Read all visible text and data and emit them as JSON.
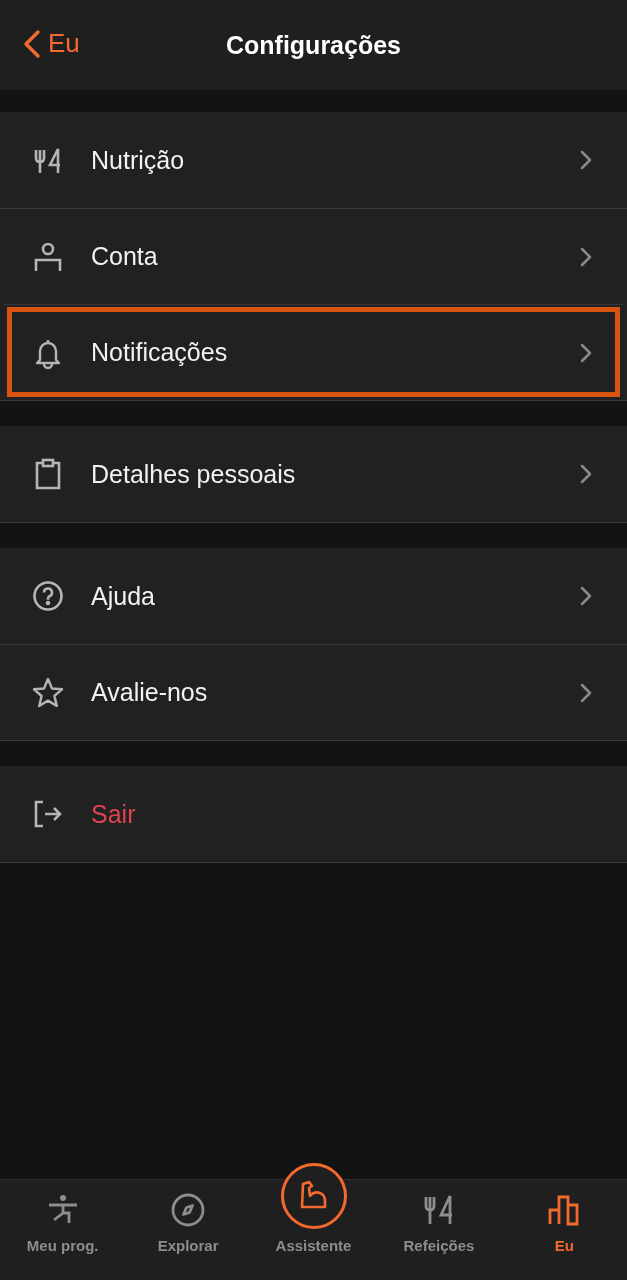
{
  "header": {
    "back_label": "Eu",
    "title": "Configurações"
  },
  "sections": [
    {
      "items": [
        {
          "label": "Nutrição",
          "kind": "link",
          "highlighted": false
        },
        {
          "label": "Conta",
          "kind": "link",
          "highlighted": false
        },
        {
          "label": "Notificações",
          "kind": "link",
          "highlighted": true
        }
      ]
    },
    {
      "items": [
        {
          "label": "Detalhes pessoais",
          "kind": "link",
          "highlighted": false
        }
      ]
    },
    {
      "items": [
        {
          "label": "Ajuda",
          "kind": "link",
          "highlighted": false
        },
        {
          "label": "Avalie-nos",
          "kind": "link",
          "highlighted": false
        }
      ]
    },
    {
      "items": [
        {
          "label": "Sair",
          "kind": "danger",
          "highlighted": false
        }
      ]
    }
  ],
  "tab_bar": [
    {
      "label": "Meu prog.",
      "kind": "tab",
      "selected": false
    },
    {
      "label": "Explorar",
      "kind": "tab",
      "selected": false
    },
    {
      "label": "Assistente",
      "kind": "center",
      "selected": false
    },
    {
      "label": "Refeições",
      "kind": "tab",
      "selected": false
    },
    {
      "label": "Eu",
      "kind": "tab",
      "selected": true
    }
  ]
}
